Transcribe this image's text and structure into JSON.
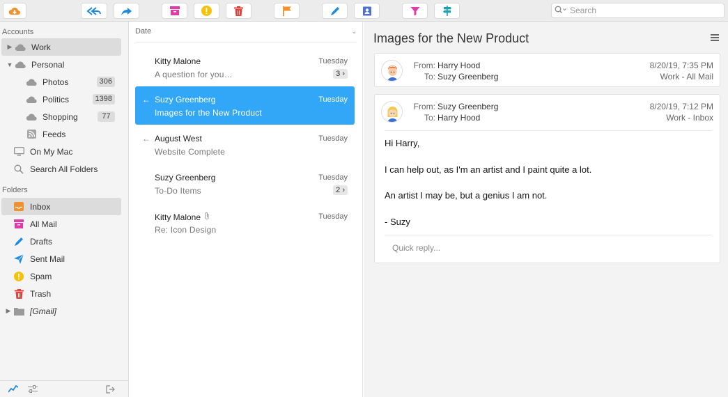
{
  "toolbar": {
    "buttons": [
      "cloud-download",
      "reply-all",
      "forward",
      "archive",
      "spam",
      "trash",
      "flag",
      "compose",
      "address-book",
      "filter",
      "signpost"
    ],
    "search_placeholder": "Search"
  },
  "sidebar": {
    "accounts_heading": "Accounts",
    "accounts": [
      {
        "label": "Work",
        "selected": true,
        "icon": "cloud-icon"
      },
      {
        "label": "Personal",
        "icon": "cloud-icon"
      },
      {
        "label": "Photos",
        "badge": "306",
        "icon": "cloud-icon"
      },
      {
        "label": "Politics",
        "badge": "1398",
        "icon": "cloud-icon"
      },
      {
        "label": "Shopping",
        "badge": "77",
        "icon": "cloud-icon"
      },
      {
        "label": "Feeds",
        "icon": "rss-icon"
      },
      {
        "label": "On My Mac",
        "icon": "computer-icon"
      },
      {
        "label": "Search All Folders",
        "icon": "search-icon"
      }
    ],
    "folders_heading": "Folders",
    "folders": [
      {
        "label": "Inbox",
        "selected": true,
        "icon": "inbox-icon",
        "color": "#f0912d"
      },
      {
        "label": "All Mail",
        "icon": "archive-icon",
        "color": "#e23aa8"
      },
      {
        "label": "Drafts",
        "icon": "pencil-icon",
        "color": "#1f8be0"
      },
      {
        "label": "Sent Mail",
        "icon": "paper-plane-icon",
        "color": "#1f8be0"
      },
      {
        "label": "Spam",
        "icon": "spam-icon",
        "color": "#f4c20d"
      },
      {
        "label": "Trash",
        "icon": "trash-icon",
        "color": "#e8413b"
      },
      {
        "label": "[Gmail]",
        "icon": "folder-icon",
        "color": "#9a9a9a"
      }
    ]
  },
  "list": {
    "sort_label": "Date",
    "messages": [
      {
        "from": "Kitty Malone",
        "subject": "A question for you…",
        "date": "Tuesday",
        "count": "3 ›"
      },
      {
        "from": "Suzy Greenberg",
        "subject": "Images for the New Product",
        "date": "Tuesday",
        "replied": "←",
        "selected": true
      },
      {
        "from": "August West",
        "subject": "Website Complete",
        "date": "Tuesday",
        "replied": "←"
      },
      {
        "from": "Suzy Greenberg",
        "subject": "To-Do Items",
        "date": "Tuesday",
        "count": "2 ›"
      },
      {
        "from": "Kitty Malone",
        "subject": "Re: Icon Design",
        "date": "Tuesday",
        "attachment": "📎"
      }
    ]
  },
  "reader": {
    "title": "Images for the New Product",
    "collapsed": {
      "from_label": "From:",
      "from": "Harry Hood",
      "to_label": "To:",
      "to": "Suzy Greenberg",
      "date": "8/20/19, 7:35 PM",
      "mailbox": "Work - All Mail"
    },
    "expanded": {
      "from_label": "From:",
      "from": "Suzy Greenberg",
      "to_label": "To:",
      "to": "Harry Hood",
      "date": "8/20/19, 7:12 PM",
      "mailbox": "Work - Inbox",
      "body": [
        "Hi Harry,",
        "I can help out, as I'm an artist and I paint quite a lot.",
        "An artist I may be, but a genius I am not.",
        "- Suzy"
      ],
      "quick_reply": "Quick reply..."
    }
  },
  "colors": {
    "accent": "#32a6f7",
    "toolbar_icon_blue": "#1f8be0",
    "pink": "#e23aa8",
    "orange": "#f0912d",
    "yellow": "#f4c20d",
    "red": "#e8413b"
  }
}
